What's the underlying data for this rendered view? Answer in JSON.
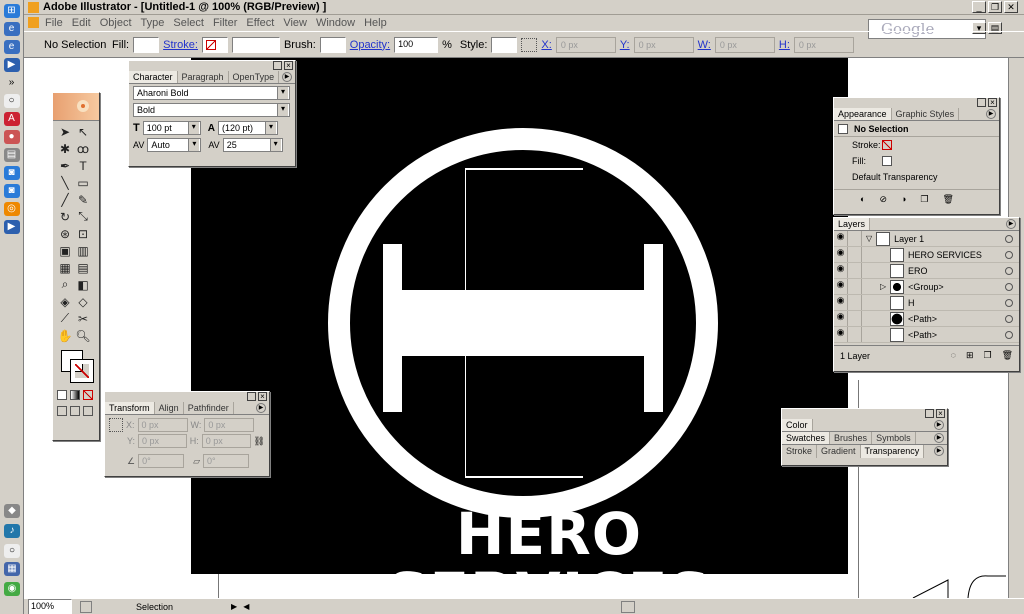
{
  "window": {
    "title": "Adobe Illustrator - [Untitled-1 @ 100% (RGB/Preview) ]",
    "minimize": "_",
    "restore": "❐",
    "close": "✕"
  },
  "menu": [
    "File",
    "Edit",
    "Object",
    "Type",
    "Select",
    "Filter",
    "Effect",
    "View",
    "Window",
    "Help"
  ],
  "search": {
    "placeholder": "Google"
  },
  "control": {
    "selection": "No Selection",
    "fill_label": "Fill:",
    "stroke_label": "Stroke:",
    "brush_label": "Brush:",
    "opacity_label": "Opacity:",
    "opacity_value": "100",
    "percent": "%",
    "style_label": "Style:",
    "x_label": "X:",
    "x_value": "0 px",
    "y_label": "Y:",
    "y_value": "0 px",
    "w_label": "W:",
    "w_value": "0 px",
    "h_label": "H:",
    "h_value": "0 px"
  },
  "character": {
    "tabs": [
      "Character",
      "Paragraph",
      "OpenType"
    ],
    "font": "Aharoni Bold",
    "style": "Bold",
    "size": "100 pt",
    "leading": "(120 pt)",
    "kerning": "Auto",
    "tracking": "25"
  },
  "transform": {
    "tabs": [
      "Transform",
      "Align",
      "Pathfinder"
    ],
    "x_label": "X:",
    "x_value": "0 px",
    "y_label": "Y:",
    "y_value": "0 px",
    "w_label": "W:",
    "w_value": "0 px",
    "h_label": "H:",
    "h_value": "0 px",
    "rotate_value": "0°",
    "shear_value": "0°"
  },
  "appearance": {
    "tabs": [
      "Appearance",
      "Graphic Styles"
    ],
    "selection": "No Selection",
    "stroke_label": "Stroke:",
    "fill_label": "Fill:",
    "transparency": "Default Transparency"
  },
  "layers": {
    "tab": "Layers",
    "rows": [
      {
        "name": "Layer 1"
      },
      {
        "name": "HERO SERVICES"
      },
      {
        "name": "ERO"
      },
      {
        "name": "<Group>"
      },
      {
        "name": "H"
      },
      {
        "name": "<Path>"
      },
      {
        "name": "<Path>"
      }
    ],
    "count": "1 Layer"
  },
  "color_palettes": {
    "color_tab": "Color",
    "tabs2": [
      "Swatches",
      "Brushes",
      "Symbols"
    ],
    "tabs3": [
      "Stroke",
      "Gradient",
      "Transparency"
    ]
  },
  "artwork": {
    "letter": "H",
    "headline": "HERO SERVICES"
  },
  "status": {
    "zoom": "100%",
    "mode": "Selection"
  },
  "colors": {
    "artboard": "#000000",
    "art_white": "#ffffff",
    "link_blue": "#2233cc",
    "chrome": "#d4d0c8"
  }
}
